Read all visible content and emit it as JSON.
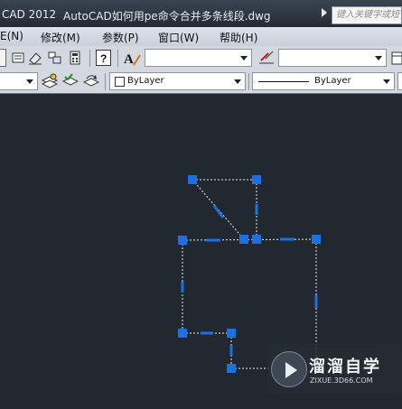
{
  "title_bar": {
    "app_title": "CAD 2012",
    "document_title": "AutoCAD如何用pe命令合并多条线段.dwg",
    "search_placeholder": "键入关键字或短"
  },
  "menu": {
    "items": [
      {
        "label": "E(N)"
      },
      {
        "label": "修改(M)"
      },
      {
        "label": "参数(P)"
      },
      {
        "label": "窗口(W)"
      },
      {
        "label": "帮助(H)"
      }
    ]
  },
  "toolbar2": {
    "color_value": "ByLayer",
    "linetype_value": "ByLayer"
  },
  "watermark": {
    "name": "溜溜自学",
    "url": "ZIXUE.3D66.COM"
  },
  "colors": {
    "canvas_bg": "#212830",
    "grip": "#1f6fe0",
    "line": "#e6e9ee"
  }
}
